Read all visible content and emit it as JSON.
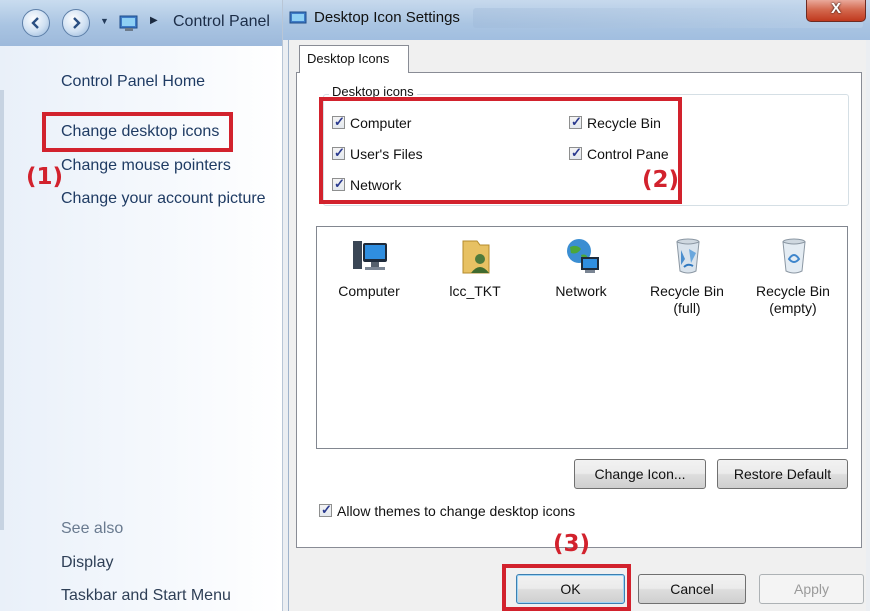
{
  "control_panel": {
    "breadcrumb": "Control Panel",
    "links": {
      "home": "Control Panel Home",
      "desktop_icons": "Change desktop icons",
      "mouse_pointers": "Change mouse pointers",
      "account_picture": "Change your account picture"
    },
    "see_also": {
      "heading": "See also",
      "display": "Display",
      "taskbar": "Taskbar and Start Menu"
    }
  },
  "dialog": {
    "title": "Desktop Icon Settings",
    "close_glyph": "X",
    "tab_label": "Desktop Icons",
    "group_label": "Desktop icons",
    "checkboxes": [
      {
        "label": "Computer",
        "checked": true
      },
      {
        "label": "User's Files",
        "checked": true
      },
      {
        "label": "Network",
        "checked": true
      },
      {
        "label": "Recycle Bin",
        "checked": true
      },
      {
        "label": "Control Pane",
        "checked": true
      }
    ],
    "preview_icons": [
      {
        "caption": "Computer",
        "icon": "computer-icon"
      },
      {
        "caption": "lcc_TKT",
        "icon": "user-folder-icon"
      },
      {
        "caption": "Network",
        "icon": "network-icon"
      },
      {
        "caption": "Recycle Bin\n(full)",
        "icon": "recycle-bin-full-icon"
      },
      {
        "caption": "Recycle Bin\n(empty)",
        "icon": "recycle-bin-empty-icon"
      }
    ],
    "buttons": {
      "change_icon": "Change Icon...",
      "restore_default": "Restore Default",
      "ok": "OK",
      "cancel": "Cancel",
      "apply": "Apply"
    },
    "allow_themes": {
      "label": "Allow themes to change desktop icons",
      "checked": true
    }
  },
  "annotations": {
    "step1": "(1)",
    "step2": "(2)",
    "step3": "(3)",
    "highlight_color": "#d2222d"
  }
}
